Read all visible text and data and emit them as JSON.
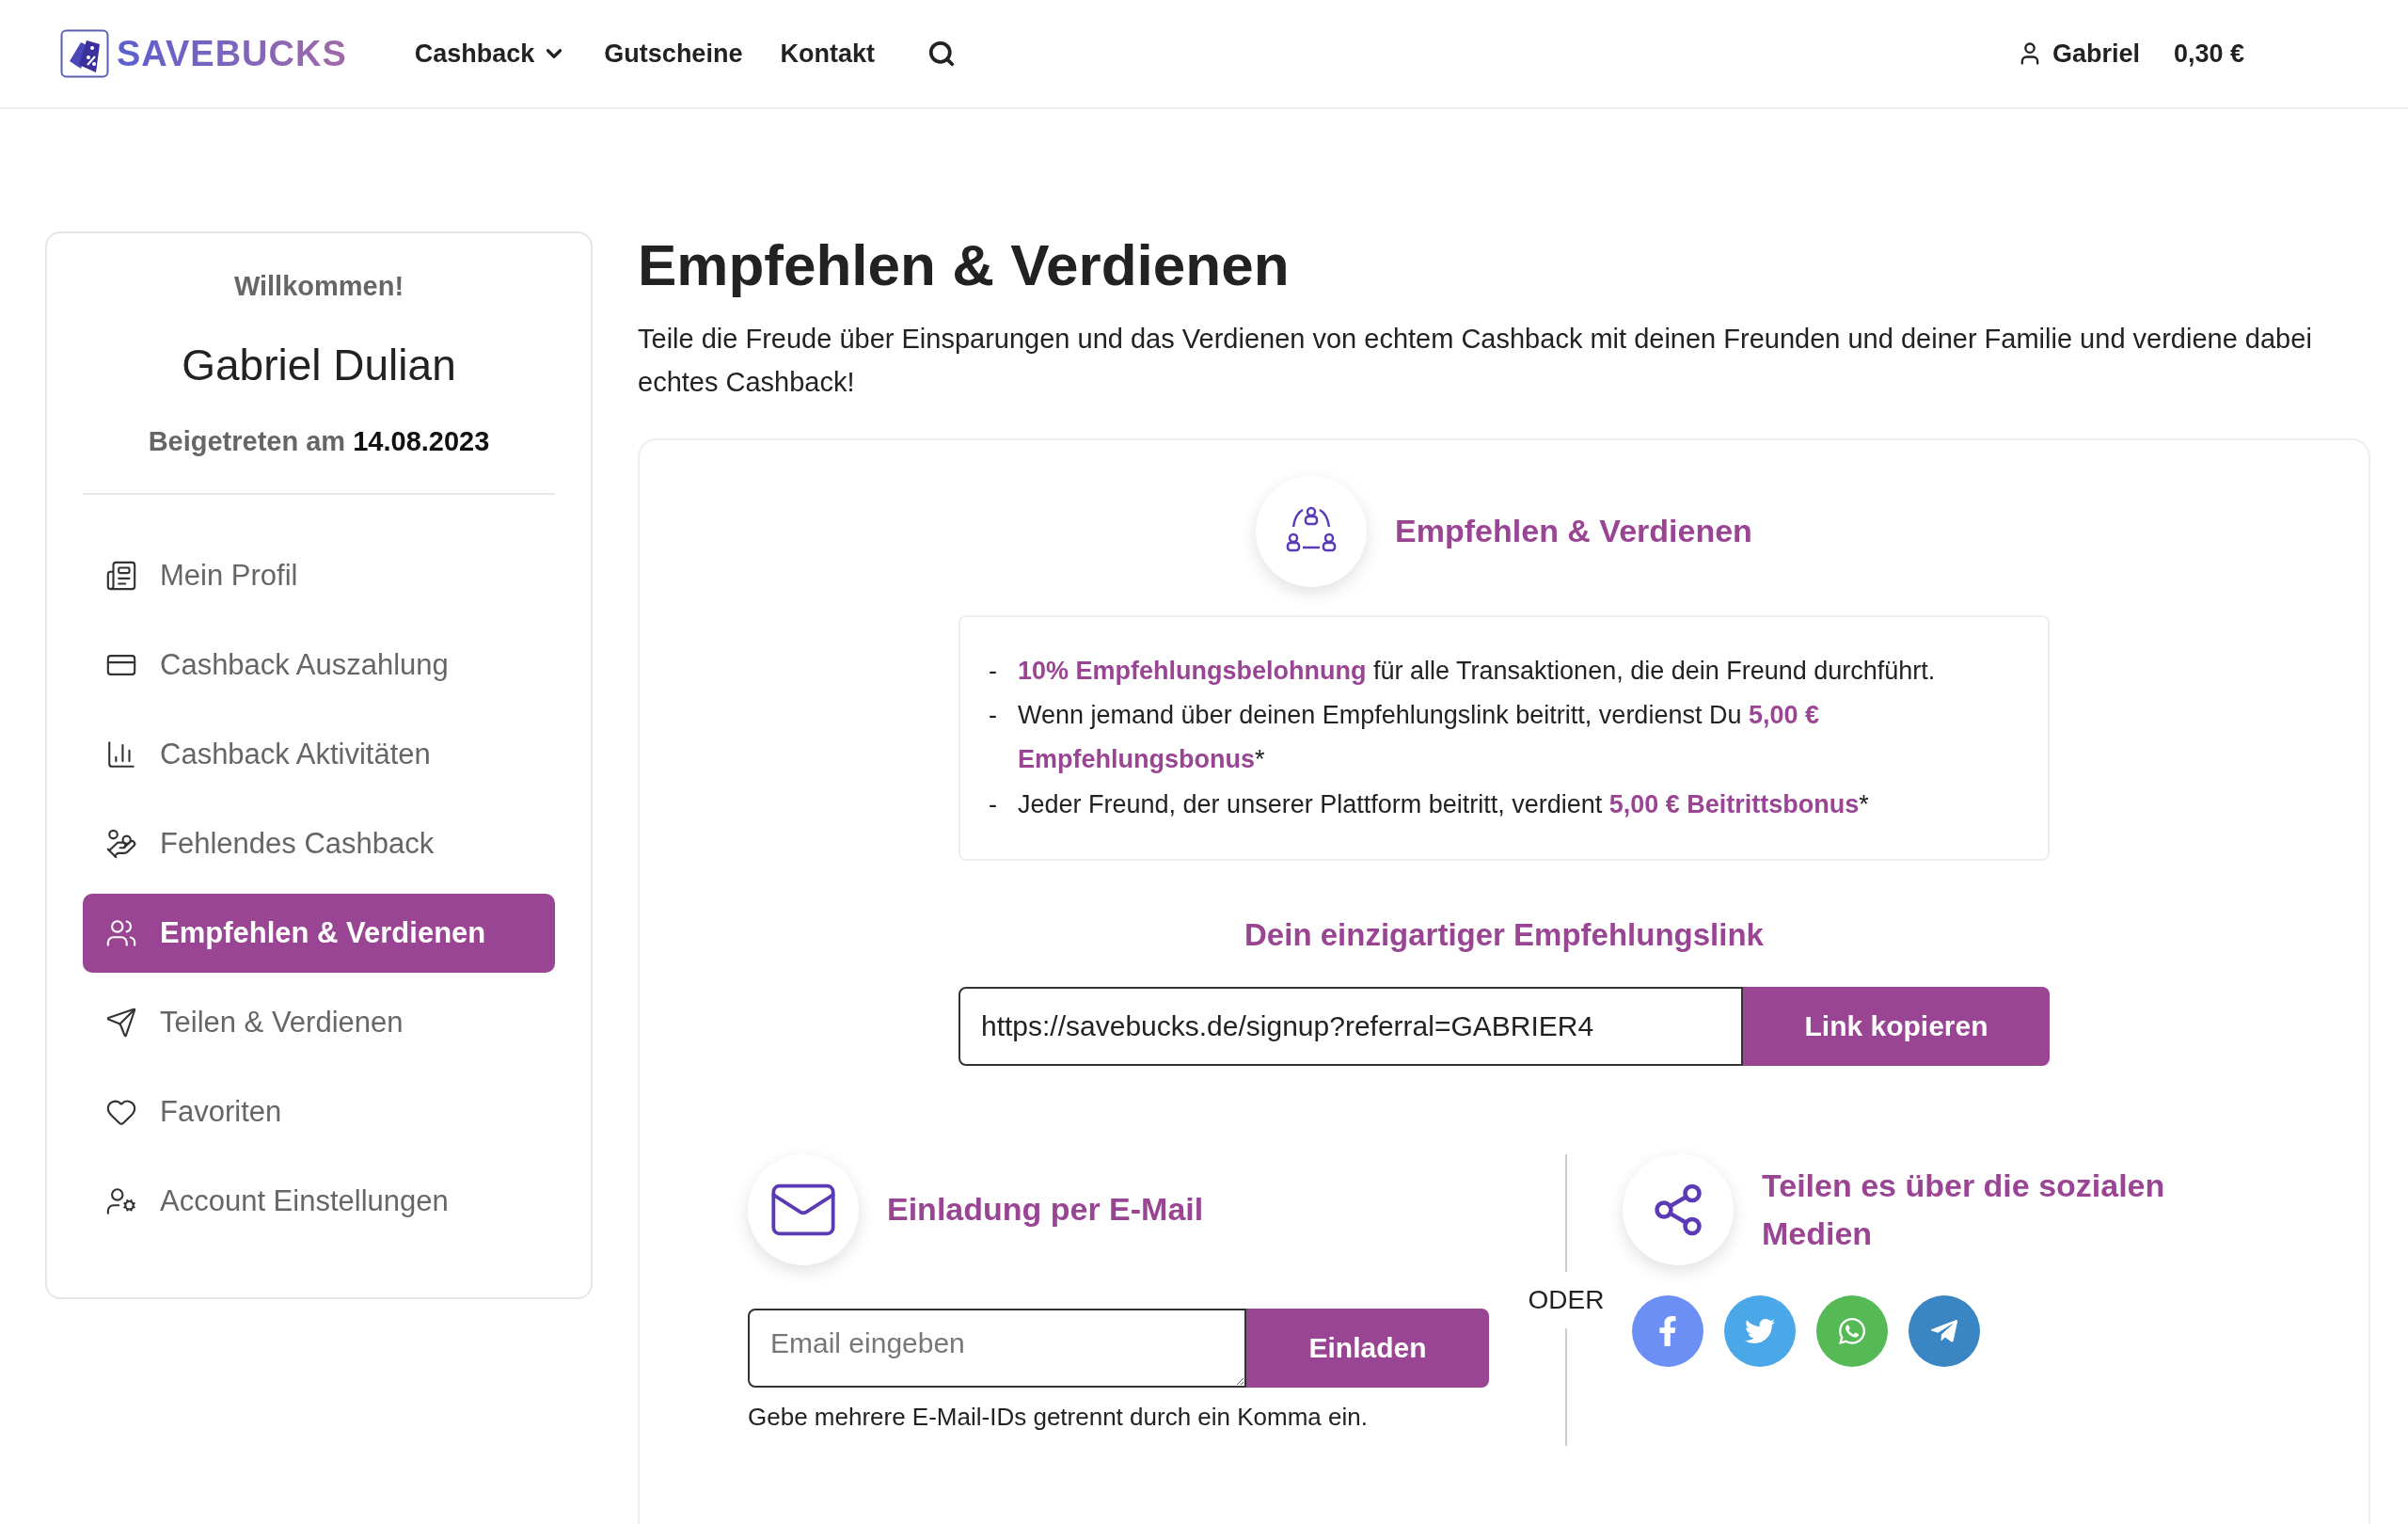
{
  "header": {
    "logo": "SAVEBUCKS",
    "nav": [
      {
        "label": "Cashback",
        "kind": "dropdown"
      },
      {
        "label": "Gutscheine",
        "kind": "link"
      },
      {
        "label": "Kontakt",
        "kind": "link"
      }
    ],
    "user": "Gabriel",
    "balance": "0,30 €"
  },
  "sidebar": {
    "welcome": "Willkommen!",
    "name": "Gabriel Dulian",
    "joined_label": "Beigetreten am",
    "joined_date": "14.08.2023",
    "items": [
      {
        "label": "Mein Profil",
        "selected": false
      },
      {
        "label": "Cashback Auszahlung",
        "selected": false
      },
      {
        "label": "Cashback Aktivitäten",
        "selected": false
      },
      {
        "label": "Fehlendes Cashback",
        "selected": false
      },
      {
        "label": "Empfehlen & Verdienen",
        "selected": true
      },
      {
        "label": "Teilen & Verdienen",
        "selected": false
      },
      {
        "label": "Favoriten",
        "selected": false
      },
      {
        "label": "Account Einstellungen",
        "selected": false
      }
    ]
  },
  "main": {
    "title": "Empfehlen & Verdienen",
    "intro": "Teile die Freude über Einsparungen und das Verdienen von echtem Cashback mit deinen Freunden und deiner Familie und verdiene dabei echtes Cashback!",
    "referral": {
      "heading": "Empfehlen & Verdienen",
      "bullets": [
        {
          "marker": "-",
          "text": "**10% Empfehlungsbelohnung** für alle Transaktionen, die dein Freund durchführt."
        },
        {
          "marker": "-",
          "text": "Wenn jemand über deinen Empfehlungslink beitritt, verdienst Du **5,00 € Empfehlungsbonus***"
        },
        {
          "marker": "-",
          "text": "Jeder Freund, der unserer Plattform beitritt, verdient **5,00 € Beitrittsbonus***"
        }
      ]
    },
    "link": {
      "heading": "Dein einzigartiger Empfehlungslink",
      "value": "https://savebucks.de/signup?referral=GABRIER4",
      "button": "Link kopieren"
    },
    "email": {
      "heading": "Einladung per E-Mail",
      "placeholder": "Email eingeben",
      "button": "Einladen",
      "hint": "Gebe mehrere E-Mail-IDs getrennt durch ein Komma ein."
    },
    "divider": "ODER",
    "social": {
      "heading": "Teilen es über die sozialen Medien",
      "buttons": [
        {
          "kind": "facebook",
          "color": "#6b8ff5"
        },
        {
          "kind": "twitter",
          "color": "#4aa8e8"
        },
        {
          "kind": "whatsapp",
          "color": "#55b956"
        },
        {
          "kind": "telegram",
          "color": "#3a85c4"
        }
      ]
    }
  }
}
